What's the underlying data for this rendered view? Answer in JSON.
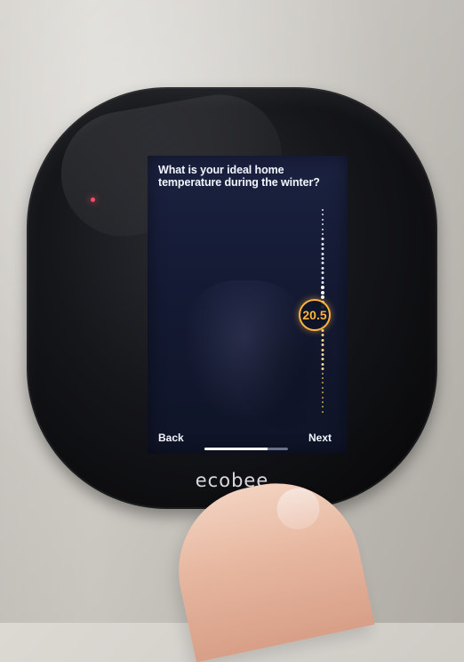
{
  "screen": {
    "question": "What is your ideal home\ntemperature during the winter?",
    "temperature_value": "20.5",
    "back_label": "Back",
    "next_label": "Next",
    "progress_value": 0.76
  },
  "brand": {
    "label": "ecobee"
  },
  "colors": {
    "accent": "#ffb340",
    "screen_bg": "#151b34",
    "text": "#f4f6ff"
  }
}
